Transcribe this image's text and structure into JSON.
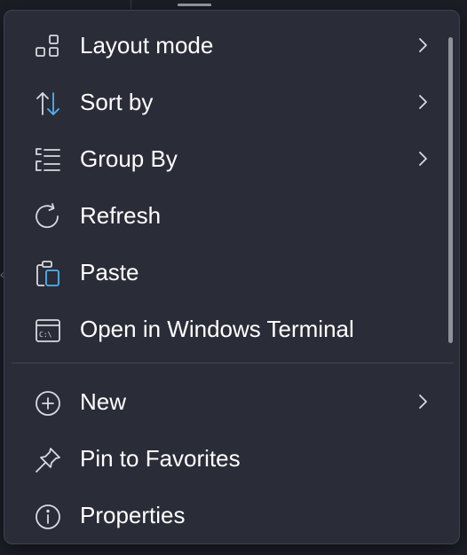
{
  "menu": {
    "items": [
      {
        "label": "Layout mode",
        "icon": "layout-grid-icon",
        "has_submenu": true
      },
      {
        "label": "Sort by",
        "icon": "sort-arrows-icon",
        "has_submenu": true
      },
      {
        "label": "Group By",
        "icon": "group-list-icon",
        "has_submenu": true
      },
      {
        "label": "Refresh",
        "icon": "refresh-icon",
        "has_submenu": false
      },
      {
        "label": "Paste",
        "icon": "paste-icon",
        "has_submenu": false
      },
      {
        "label": "Open in Windows Terminal",
        "icon": "terminal-icon",
        "has_submenu": false
      },
      {
        "label": "New",
        "icon": "plus-circle-icon",
        "has_submenu": true
      },
      {
        "label": "Pin to Favorites",
        "icon": "pin-icon",
        "has_submenu": false
      },
      {
        "label": "Properties",
        "icon": "info-icon",
        "has_submenu": false
      }
    ]
  },
  "colors": {
    "menu_background": "#2a2c38",
    "text": "#ffffff",
    "accent": "#4fb3f0",
    "icon": "#d9dae0"
  }
}
